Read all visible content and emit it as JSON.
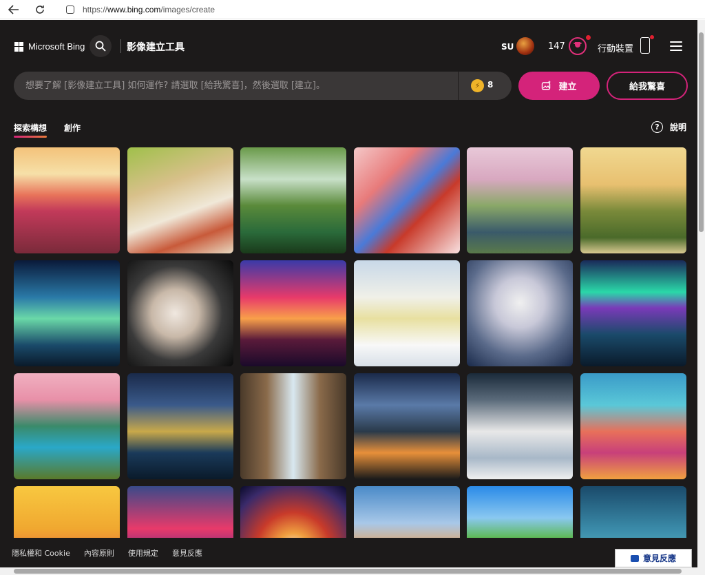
{
  "browser": {
    "url_prefix": "https://",
    "url_host": "www.bing.com",
    "url_path": "/images/create"
  },
  "header": {
    "brand": "Microsoft Bing",
    "title": "影像建立工具",
    "user_initials": "SU",
    "points": "147",
    "mobile_label": "行動裝置"
  },
  "prompt": {
    "placeholder": "想要了解 [影像建立工具] 如何運作? 請選取 [給我驚喜]，然後選取 [建立]。",
    "boosts": "8",
    "create_label": "建立",
    "surprise_label": "給我驚喜"
  },
  "tabs": [
    {
      "label": "探索構想"
    },
    {
      "label": "創作"
    }
  ],
  "help_label": "說明",
  "gallery": [
    {
      "name": "tulip-field-sunset",
      "bg": "linear-gradient(180deg,#f3c27a 0%,#f6e0a8 25%,#e8735a 45%,#c23a5a 60%,#7a2a3a 100%)"
    },
    {
      "name": "picnic-basket",
      "bg": "linear-gradient(160deg,#9fc04a 0%,#d8c08a 35%,#f0e8d8 60%,#c85a3a 80%,#e8d8c0 100%)"
    },
    {
      "name": "waterfall-rainbow",
      "bg": "linear-gradient(180deg,#6a9a4a 0%,#c8e0c8 30%,#5a8a3a 55%,#2a6a3a 80%,#1a3a1a 100%)"
    },
    {
      "name": "butterfly-blossom",
      "bg": "linear-gradient(135deg,#f4c8c8 0%,#e87a7a 30%,#4a7ad8 50%,#c83a2a 65%,#f8e0e0 100%)"
    },
    {
      "name": "cherry-river",
      "bg": "linear-gradient(180deg,#e8c8d8 0%,#d8a8c0 30%,#8aa868 55%,#3a5a6a 80%,#5a7a4a 100%)"
    },
    {
      "name": "park-kite",
      "bg": "linear-gradient(180deg,#f0d890 0%,#e8c070 35%,#7a8a3a 60%,#4a6a2a 85%,#d8c890 100%)"
    },
    {
      "name": "neon-forest",
      "bg": "linear-gradient(180deg,#0a1a3a 0%,#2a7aa8 35%,#6ad8a8 55%,#1a4a6a 80%,#0a1a2a 100%)"
    },
    {
      "name": "crescent-flowers",
      "bg": "radial-gradient(circle at 45% 50%,#f0e8e0 0%,#c8b8a8 30%,#3a3a3a 60%,#0a0a0a 100%)"
    },
    {
      "name": "horse-rider-sunset",
      "bg": "linear-gradient(180deg,#3a3aa8 0%,#e83a6a 35%,#f8a04a 55%,#5a1a3a 75%,#1a0a2a 100%)"
    },
    {
      "name": "polar-bears-lemonade",
      "bg": "linear-gradient(180deg,#c8d8e8 0%,#f0f0e8 35%,#e8e0a0 55%,#f8f8f8 80%,#d8e0e8 100%)"
    },
    {
      "name": "silver-bouquet",
      "bg": "radial-gradient(circle at 50% 40%,#f0f0f0 0%,#c8c8d8 30%,#5a6a8a 65%,#1a2a4a 100%)"
    },
    {
      "name": "aurora-shore",
      "bg": "linear-gradient(180deg,#1a2a5a 0%,#2ad8a8 30%,#7a3ab8 45%,#1a4a6a 70%,#0a1a2a 100%)"
    },
    {
      "name": "peacock-garden",
      "bg": "linear-gradient(180deg,#f0b0c0 0%,#e890a8 25%,#3a8a6a 50%,#2aa8c8 70%,#5a7a2a 100%)"
    },
    {
      "name": "night-city",
      "bg": "linear-gradient(180deg,#1a2a4a 0%,#3a5a8a 30%,#c8a84a 55%,#1a3a5a 75%,#0a1a2a 100%)"
    },
    {
      "name": "library-robot",
      "bg": "linear-gradient(90deg,#4a3a2a 0%,#8a6a4a 25%,#d8e8f0 50%,#8a6a4a 75%,#4a3a2a 100%)"
    },
    {
      "name": "campsite-milkyway",
      "bg": "linear-gradient(180deg,#1a2a4a 0%,#5a7aa8 30%,#2a3a4a 55%,#e8903a 75%,#1a1a1a 100%)"
    },
    {
      "name": "polar-bear-moon",
      "bg": "linear-gradient(180deg,#1a2a3a 0%,#5a6a7a 25%,#e8e8e8 55%,#a8b8c8 80%,#f0f0f0 100%)"
    },
    {
      "name": "sea-turtle-reef",
      "bg": "linear-gradient(180deg,#3a9ac8 0%,#5ac8d8 30%,#e8705a 55%,#c8407a 75%,#f0a040 100%)"
    },
    {
      "name": "ferris-wheel",
      "bg": "linear-gradient(180deg,#f8c840 0%,#f0a830 40%,#e86a3a 70%,#8a2a2a 100%)"
    },
    {
      "name": "space-ship",
      "bg": "linear-gradient(180deg,#3a4a8a 0%,#e83a6a 40%,#5a2a8a 70%,#1a0a2a 100%)"
    },
    {
      "name": "fire-phoenix",
      "bg": "radial-gradient(circle at 50% 60%,#f8f0e0 0%,#f0a040 20%,#c83a2a 45%,#3a2a6a 80%,#0a0a2a 100%)"
    },
    {
      "name": "elephant-sunset",
      "bg": "linear-gradient(180deg,#4a8ac8 0%,#a8c8e8 35%,#e8a05a 60%,#8a6a5a 100%)"
    },
    {
      "name": "floating-islands",
      "bg": "linear-gradient(180deg,#2a8ae8 0%,#8ac8f0 30%,#5ab84a 50%,#e8c84a 70%,#c83a8a 100%)"
    },
    {
      "name": "underwater-city",
      "bg": "linear-gradient(180deg,#1a4a6a 0%,#3a8aa8 40%,#5ab8c8 70%,#1a3a4a 100%)"
    }
  ],
  "footer": {
    "links": [
      "隱私權和 Cookie",
      "內容原則",
      "使用規定",
      "意見反應"
    ],
    "feedback_label": "意見反應"
  }
}
